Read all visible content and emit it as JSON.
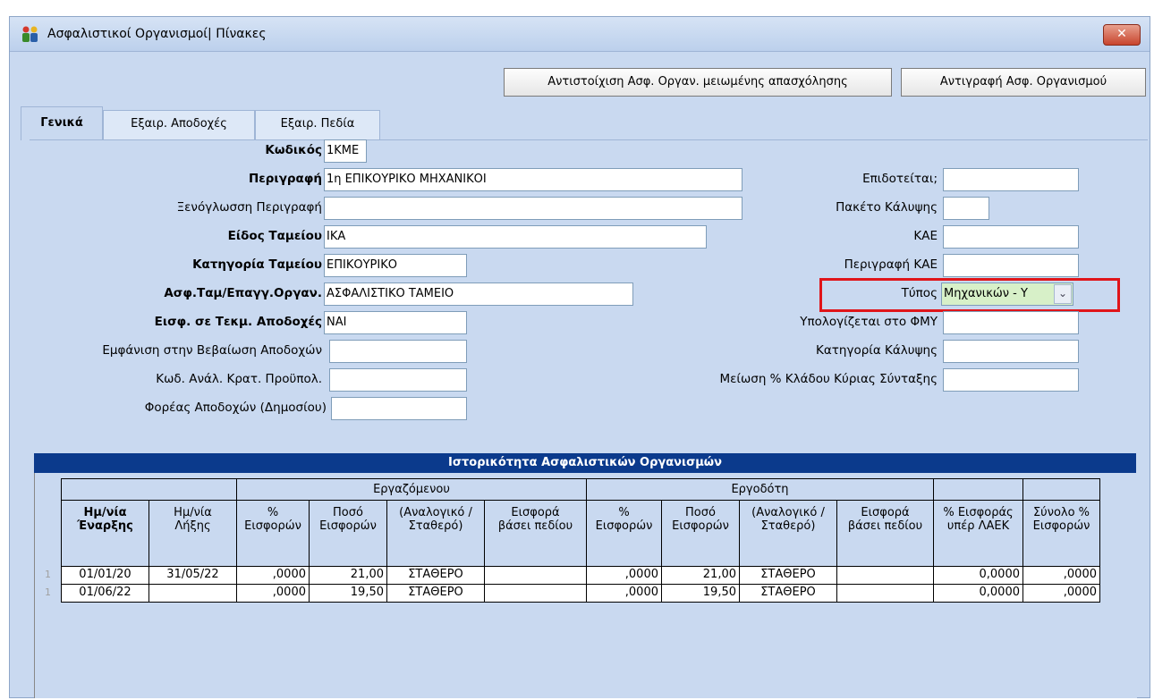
{
  "window": {
    "title": "Ασφαλιστικοί Οργανισμοί| Πίνακες",
    "close_label": "✕"
  },
  "toolbar": {
    "btn_mapping": "Αντιστοίχιση Ασφ. Οργαν. μειωμένης απασχόλησης",
    "btn_copy": "Αντιγραφή Ασφ. Οργανισμού"
  },
  "tabs": [
    {
      "label": "Γενικά",
      "active": true
    },
    {
      "label": "Εξαιρ. Αποδοχές",
      "active": false
    },
    {
      "label": "Εξαιρ. Πεδία",
      "active": false
    }
  ],
  "form_left": {
    "kodikos": {
      "label": "Κωδικός",
      "value": "1ΚΜΕ"
    },
    "perigrafi": {
      "label": "Περιγραφή",
      "value": "1η ΕΠΙΚΟΥΡΙΚΟ ΜΗΧΑΝΙΚΟΙ"
    },
    "xenoglossi": {
      "label": "Ξενόγλωσση Περιγραφή",
      "value": ""
    },
    "eidos": {
      "label": "Είδος Ταμείου",
      "value": "ΙΚΑ"
    },
    "katigoria": {
      "label": "Κατηγορία Ταμείου",
      "value": "ΕΠΙΚΟΥΡΙΚΟ"
    },
    "asf_tam": {
      "label": "Ασφ.Ταμ/Επαγγ.Οργαν.",
      "value": "ΑΣΦΑΛΙΣΤΙΚΟ ΤΑΜΕΙΟ"
    },
    "eisf": {
      "label": "Εισφ. σε Τεκμ. Αποδοχές",
      "value": "ΝΑΙ"
    },
    "emfanisi": {
      "label": "Εμφάνιση στην Βεβαίωση Αποδοχών",
      "value": ""
    },
    "kod_anal": {
      "label": "Κωδ. Ανάλ. Κρατ. Προϋπολ.",
      "value": ""
    },
    "foreas": {
      "label": "Φορέας Αποδοχών (Δημοσίου)",
      "value": ""
    }
  },
  "form_right": {
    "epidoteitai": {
      "label": "Επιδοτείται;",
      "value": ""
    },
    "paketo": {
      "label": "Πακέτο Κάλυψης",
      "value": ""
    },
    "kae": {
      "label": "ΚΑΕ",
      "value": ""
    },
    "perigrafi_kae": {
      "label": "Περιγραφή ΚΑΕ",
      "value": ""
    },
    "typos": {
      "label": "Τύπος",
      "value": "Μηχανικών - Υ"
    },
    "ypologizetai": {
      "label": "Υπολογίζεται στο ΦΜΥ",
      "value": ""
    },
    "kat_kalypsis": {
      "label": "Κατηγορία Κάλυψης",
      "value": ""
    },
    "meiosi": {
      "label": "Μείωση % Κλάδου Κύριας Σύνταξης",
      "value": ""
    }
  },
  "grid": {
    "title": "Ιστορικότητα Ασφαλιστικών Οργανισμών",
    "group_employee": "Εργαζόμενου",
    "group_employer": "Εργοδότη",
    "columns": [
      {
        "l1": "Ημ/νία",
        "l2": "Έναρξης"
      },
      {
        "l1": "Ημ/νία",
        "l2": "Λήξης"
      },
      {
        "l1": "%",
        "l2": "Εισφορών"
      },
      {
        "l1": "Ποσό",
        "l2": "Εισφορών"
      },
      {
        "l1": "(Αναλογικό /",
        "l2": "Σταθερό)"
      },
      {
        "l1": "Εισφορά",
        "l2": "βάσει πεδίου"
      },
      {
        "l1": "%",
        "l2": "Εισφορών"
      },
      {
        "l1": "Ποσό",
        "l2": "Εισφορών"
      },
      {
        "l1": "(Αναλογικό /",
        "l2": "Σταθερό)"
      },
      {
        "l1": "Εισφορά",
        "l2": "βάσει πεδίου"
      },
      {
        "l1": "% Εισφοράς",
        "l2": "υπέρ ΛΑΕΚ"
      },
      {
        "l1": "Σύνολο %",
        "l2": "Εισφορών"
      }
    ],
    "rows": [
      {
        "marker": "1",
        "cells": [
          "01/01/20",
          "31/05/22",
          ",0000",
          "21,00",
          "ΣΤΑΘΕΡΟ",
          "",
          ",0000",
          "21,00",
          "ΣΤΑΘΕΡΟ",
          "",
          "0,0000",
          ",0000"
        ]
      },
      {
        "marker": "1",
        "cells": [
          "01/06/22",
          "",
          ",0000",
          "19,50",
          "ΣΤΑΘΕΡΟ",
          "",
          ",0000",
          "19,50",
          "ΣΤΑΘΕΡΟ",
          "",
          "0,0000",
          ",0000"
        ]
      }
    ]
  }
}
